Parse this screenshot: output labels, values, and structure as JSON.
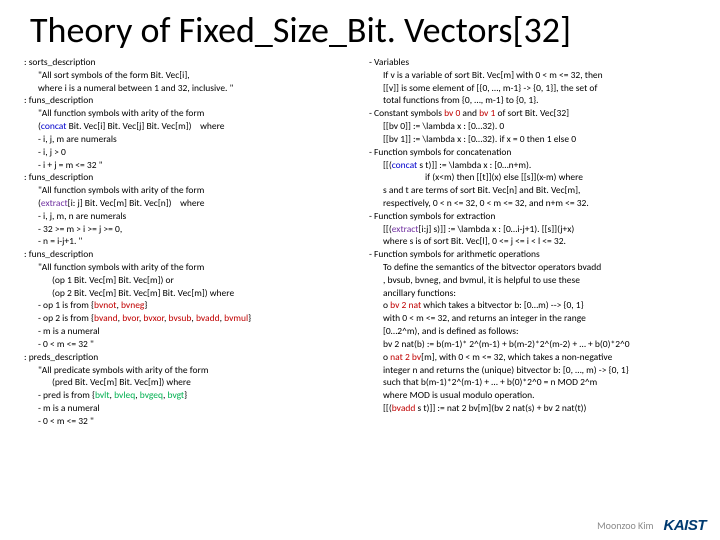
{
  "title": "Theory of Fixed_Size_Bit. Vectors[32]",
  "left": [
    {
      "c": "l0",
      "t": ": sorts_description"
    },
    {
      "c": "l1",
      "t": "\"All sort symbols of the form Bit. Vec[i],"
    },
    {
      "c": "l1",
      "t": "where i is a numeral between 1 and 32, inclusive. \""
    },
    {
      "c": "l0",
      "t": ": funs_description"
    },
    {
      "c": "l1",
      "t": "\"All function symbols with arity of the form"
    },
    {
      "c": "l1",
      "html": "(<span class='kw'>concat</span> Bit. Vec[i] Bit. Vec[j] Bit. Vec[m])&nbsp;&nbsp;&nbsp;&nbsp;where"
    },
    {
      "c": "l1",
      "t": "- i, j, m are numerals"
    },
    {
      "c": "l1",
      "t": "- i, j > 0"
    },
    {
      "c": "l1",
      "t": "- i + j = m <= 32   \""
    },
    {
      "c": "l0",
      "t": ": funs_description"
    },
    {
      "c": "l1",
      "t": "\"All function symbols with arity of the form"
    },
    {
      "c": "l1",
      "html": "(<span class='pur'>extract</span>[i: j] Bit. Vec[m] Bit. Vec[n])&nbsp;&nbsp;&nbsp;&nbsp;where"
    },
    {
      "c": "l1",
      "t": "- i, j, m, n are numerals"
    },
    {
      "c": "l1",
      "t": "- 32 >= m > i >= j >= 0,"
    },
    {
      "c": "l1",
      "t": "- n = i-j+1.   \""
    },
    {
      "c": "l0",
      "t": ": funs_description"
    },
    {
      "c": "l1",
      "t": "\"All function symbols with arity of the form"
    },
    {
      "c": "l2",
      "t": "(op 1 Bit. Vec[m] Bit. Vec[m])    or"
    },
    {
      "c": "l2",
      "t": "(op 2 Bit. Vec[m] Bit. Vec[m] Bit. Vec[m])    where"
    },
    {
      "c": "l1",
      "html": "- op 1 is from {<span class='red'>bvnot</span>, <span class='red'>bvneg</span>}"
    },
    {
      "c": "l1",
      "html": "- op 2 is from {<span class='red'>bvand</span>, <span class='red'>bvor</span>, <span class='red'>bvxor</span>, <span class='red'>bvsub</span>, <span class='red'>bvadd</span>, <span class='red'>bvmul</span>}"
    },
    {
      "c": "l1",
      "t": "- m is a numeral"
    },
    {
      "c": "l1",
      "t": "- 0 < m <= 32 \""
    },
    {
      "c": "l0",
      "t": ": preds_description"
    },
    {
      "c": "l1",
      "t": "\"All predicate symbols with arity of the form"
    },
    {
      "c": "l2",
      "t": "(pred Bit. Vec[m] Bit. Vec[m])    where"
    },
    {
      "c": "l1",
      "html": "- pred is from {<span class='grn'>bvlt</span>, <span class='grn'>bvleq</span>, <span class='grn'>bvgeq</span>, <span class='grn'>bvgt</span>}"
    },
    {
      "c": "l1",
      "t": "- m is a numeral"
    },
    {
      "c": "l1",
      "t": "- 0 < m <= 32   \""
    }
  ],
  "right": [
    {
      "c": "l0",
      "t": "- Variables"
    },
    {
      "c": "l1",
      "t": "If v is a variable of sort Bit. Vec[m] with 0 < m <= 32, then"
    },
    {
      "c": "l1",
      "t": "[[v]] is some element of [{0, …, m-1} -> {0, 1}], the set of"
    },
    {
      "c": "l1",
      "t": "total  functions from {0, …, m-1} to {0, 1}."
    },
    {
      "c": "l0",
      "html": "- Constant symbols <span class='red'>bv 0</span> and <span class='red'>bv 1</span> of sort Bit. Vec[32]"
    },
    {
      "c": "l1",
      "t": "[[bv 0]] := \\lambda x : [0…32). 0"
    },
    {
      "c": "l1",
      "t": "[[bv 1]] := \\lambda x : [0…32). if x = 0 then 1 else 0"
    },
    {
      "c": "l0",
      "t": "- Function symbols for concatenation"
    },
    {
      "c": "l1",
      "html": "[[(<span class='kw'>concat</span> s t)]] := \\lambda x : [0…n+m)."
    },
    {
      "c": "l4",
      "t": "if (x<m) then [[t]](x) else [[s]](x-m)  where"
    },
    {
      "c": "l1",
      "t": "s and t are terms of sort Bit. Vec[n] and Bit. Vec[m],"
    },
    {
      "c": "l1",
      "t": "respectively,  0 < n <= 32, 0 < m <= 32, and n+m <= 32."
    },
    {
      "c": "l0",
      "t": "- Function symbols for extraction"
    },
    {
      "c": "l1",
      "html": "[[(<span class='pur'>extract</span>[i:j] s)]] := \\lambda x : [0…i-j+1). [[s]](j+x)"
    },
    {
      "c": "l1",
      "t": "where s is of sort Bit. Vec[l], 0 <= j <= i < l <= 32."
    },
    {
      "c": "l0",
      "t": "- Function symbols for arithmetic operations"
    },
    {
      "c": "l1",
      "t": "To define the semantics of the bitvector operators bvadd"
    },
    {
      "c": "l1",
      "t": ", bvsub,  bvneg, and bvmul, it is helpful to use these"
    },
    {
      "c": "l1",
      "t": "ancillary functions:"
    },
    {
      "c": "l1",
      "html": "o <span class='red'>bv 2 nat</span> which takes a bitvector b: [0…m) --&gt; {0, 1}"
    },
    {
      "c": "l1",
      "t": " with 0 < m <= 32, and returns an integer in the range"
    },
    {
      "c": "l1",
      "t": " [0…2^m), and is defined as follows:"
    },
    {
      "c": "l1",
      "t": " bv 2 nat(b) := b(m-1)* 2^(m-1) + b(m-2)*2^(m-2) + … + b(0)*2^0"
    },
    {
      "c": "l1",
      "html": "o <span class='red'>nat 2 bv</span>[m], with 0 &lt; m &lt;= 32, which takes a non-negative"
    },
    {
      "c": "l1",
      "t": " integer n and returns the (unique) bitvector b: [0, …, m) -> {0, 1}"
    },
    {
      "c": "l1",
      "t": " such that   b(m-1)*2^(m-1) + … + b(0)*2^0 = n MOD 2^m"
    },
    {
      "c": "l1",
      "t": " where MOD is usual modulo operation."
    },
    {
      "c": "l1",
      "html": "[[(<span class='red'>bvadd</span> s t)]] := nat 2 bv[m](bv 2 nat(s) + bv 2 nat(t))"
    }
  ],
  "footer": {
    "attrib": "Moonzoo Kim",
    "logo": "KAIST"
  }
}
